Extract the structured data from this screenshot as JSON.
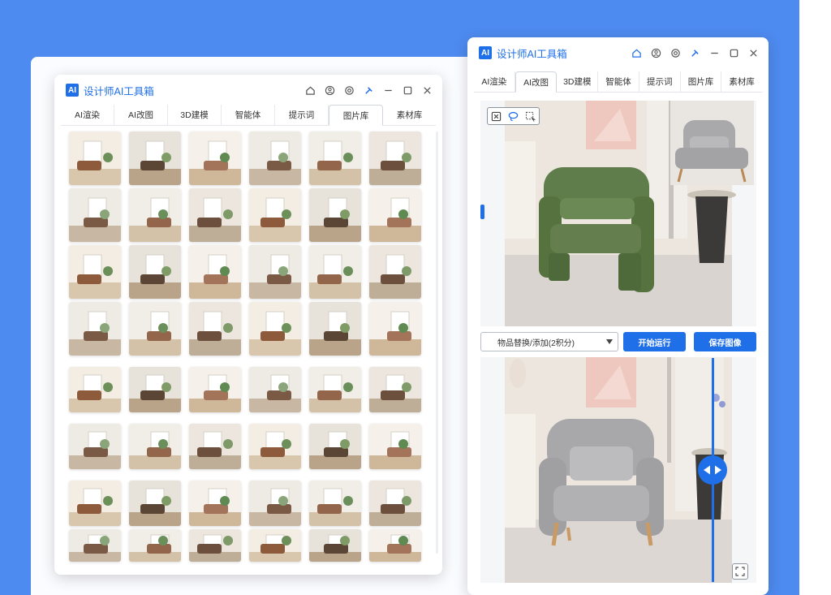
{
  "app_title": "设计师AI工具箱",
  "logo_text": "AI",
  "left_tabs": [
    "AI渲染",
    "AI改图",
    "3D建模",
    "智能体",
    "提示词",
    "图片库",
    "素材库"
  ],
  "right_tabs": [
    "AI渲染",
    "AI改图",
    "3D建模",
    "智能体",
    "提示词",
    "图片库",
    "素材库"
  ],
  "right_panel": {
    "operation_select": "物品替换/添加(2积分)",
    "run_button": "开始运行",
    "save_button": "保存图像"
  },
  "colors": {
    "accent": "#1f6fe8",
    "background": "#4e8bf0"
  },
  "icons": [
    "home-icon",
    "user-icon",
    "settings-icon",
    "pin-icon",
    "minimize-icon",
    "maximize-icon",
    "close-icon",
    "clear-icon",
    "lasso-icon",
    "box-select-icon",
    "expand-icon",
    "arrows-icon"
  ]
}
